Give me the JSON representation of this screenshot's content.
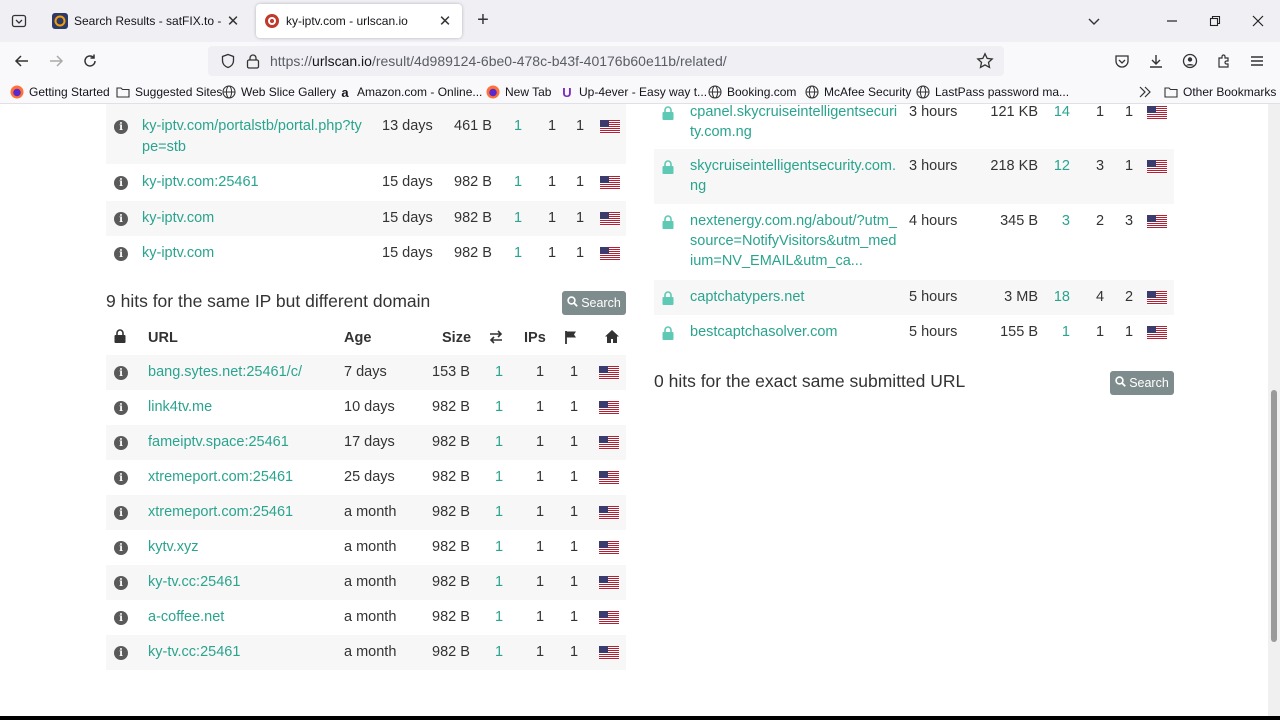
{
  "browser": {
    "tabs": [
      {
        "title": "Search Results - satFIX.to - FTA",
        "active": false
      },
      {
        "title": "ky-iptv.com - urlscan.io",
        "active": true
      }
    ],
    "url_scheme": "https://",
    "url_host": "urlscan.io",
    "url_path": "/result/4d989124-6be0-478c-b43f-40176b60e11b/related/",
    "bookmarks": [
      {
        "label": "Getting Started",
        "icon": "firefox-icon"
      },
      {
        "label": "Suggested Sites",
        "icon": "folder-icon"
      },
      {
        "label": "Web Slice Gallery",
        "icon": "globe-icon"
      },
      {
        "label": "Amazon.com - Online...",
        "icon": "amazon-icon"
      },
      {
        "label": "New Tab",
        "icon": "firefox-icon"
      },
      {
        "label": "Up-4ever - Easy way t...",
        "icon": "u-icon"
      },
      {
        "label": "Booking.com",
        "icon": "globe-icon"
      },
      {
        "label": "McAfee Security",
        "icon": "globe-icon"
      },
      {
        "label": "LastPass password ma...",
        "icon": "globe-icon"
      }
    ],
    "other_bookmarks": "Other Bookmarks"
  },
  "left_top_rows": [
    {
      "url_line1": "ky-iptv.com/portalstb/portal.php?ty",
      "url_line2": "pe=stb",
      "age": "13 days",
      "size": "461 B",
      "requests": "1",
      "ips": "1",
      "countries": "1"
    },
    {
      "url_line1": "ky-iptv.com:25461",
      "url_line2": "",
      "age": "15 days",
      "size": "982 B",
      "requests": "1",
      "ips": "1",
      "countries": "1"
    },
    {
      "url_line1": "ky-iptv.com",
      "url_line2": "",
      "age": "15 days",
      "size": "982 B",
      "requests": "1",
      "ips": "1",
      "countries": "1"
    },
    {
      "url_line1": "ky-iptv.com",
      "url_line2": "",
      "age": "15 days",
      "size": "982 B",
      "requests": "1",
      "ips": "1",
      "countries": "1"
    }
  ],
  "ip_section": {
    "heading": "9 hits for the same IP but different domain",
    "search_label": "Search",
    "columns": {
      "url": "URL",
      "age": "Age",
      "size": "Size",
      "ips": "IPs"
    },
    "rows": [
      {
        "url": "bang.sytes.net:25461/c/",
        "age": "7 days",
        "size": "153 B",
        "requests": "1",
        "ips": "1",
        "countries": "1"
      },
      {
        "url": "link4tv.me",
        "age": "10 days",
        "size": "982 B",
        "requests": "1",
        "ips": "1",
        "countries": "1"
      },
      {
        "url": "fameiptv.space:25461",
        "age": "17 days",
        "size": "982 B",
        "requests": "1",
        "ips": "1",
        "countries": "1"
      },
      {
        "url": "xtremeport.com:25461",
        "age": "25 days",
        "size": "982 B",
        "requests": "1",
        "ips": "1",
        "countries": "1"
      },
      {
        "url": "xtremeport.com:25461",
        "age": "a month",
        "size": "982 B",
        "requests": "1",
        "ips": "1",
        "countries": "1"
      },
      {
        "url": "kytv.xyz",
        "age": "a month",
        "size": "982 B",
        "requests": "1",
        "ips": "1",
        "countries": "1"
      },
      {
        "url": "ky-tv.cc:25461",
        "age": "a month",
        "size": "982 B",
        "requests": "1",
        "ips": "1",
        "countries": "1"
      },
      {
        "url": "a-coffee.net",
        "age": "a month",
        "size": "982 B",
        "requests": "1",
        "ips": "1",
        "countries": "1"
      },
      {
        "url": "ky-tv.cc:25461",
        "age": "a month",
        "size": "982 B",
        "requests": "1",
        "ips": "1",
        "countries": "1"
      }
    ]
  },
  "right_rows": [
    {
      "lines": [
        "cpanel.skycruiseintelligentsecuri",
        "ty.com.ng"
      ],
      "age": "3 hours",
      "size": "121 KB",
      "requests": "14",
      "ips": "1",
      "countries": "1"
    },
    {
      "lines": [
        "skycruiseintelligentsecurity.com.",
        "ng"
      ],
      "age": "3 hours",
      "size": "218 KB",
      "requests": "12",
      "ips": "3",
      "countries": "1"
    },
    {
      "lines": [
        "nextenergy.com.ng/about/?utm_",
        "source=NotifyVisitors&utm_med",
        "ium=NV_EMAIL&utm_ca..."
      ],
      "age": "4 hours",
      "size": "345 B",
      "requests": "3",
      "ips": "2",
      "countries": "3"
    },
    {
      "lines": [
        "captchatypers.net"
      ],
      "age": "5 hours",
      "size": "3 MB",
      "requests": "18",
      "ips": "4",
      "countries": "2"
    },
    {
      "lines": [
        "bestcaptchasolver.com"
      ],
      "age": "5 hours",
      "size": "155 B",
      "requests": "1",
      "ips": "1",
      "countries": "1"
    }
  ],
  "exact_section": {
    "heading": "0 hits for the exact same submitted URL",
    "search_label": "Search"
  },
  "colors": {
    "link": "#2aa48f",
    "lock": "#5ec9b4",
    "search_button": "#7f8c8d",
    "stripe": "#f7f7f7"
  }
}
